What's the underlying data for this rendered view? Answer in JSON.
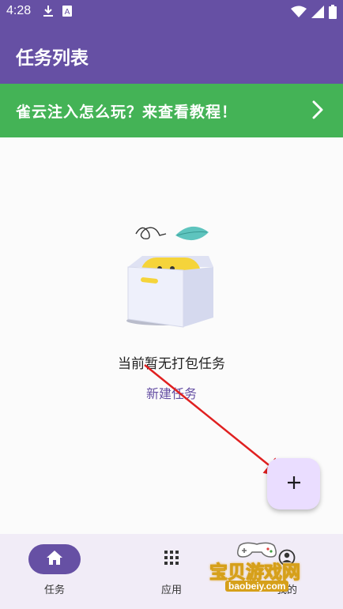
{
  "status_bar": {
    "time": "4:28",
    "left_icons": [
      "download-icon",
      "a-notification-icon"
    ],
    "right_icons": [
      "wifi-icon",
      "signal-icon",
      "battery-icon"
    ]
  },
  "app_bar": {
    "title": "任务列表"
  },
  "banner": {
    "text": "雀云注入怎么玩？来查看教程！",
    "chevron_icon": "chevron-right-icon",
    "color": "#44b356"
  },
  "empty_state": {
    "message": "当前暂无打包任务",
    "action_label": "新建任务",
    "illustration_icon": "empty-box-icon"
  },
  "fab": {
    "label": "+",
    "icon": "plus-icon",
    "color": "#eaddff"
  },
  "bottom_nav": {
    "items": [
      {
        "label": "任务",
        "icon": "home-icon",
        "active": true
      },
      {
        "label": "应用",
        "icon": "apps-grid-icon",
        "active": false
      },
      {
        "label": "我的",
        "icon": "person-icon",
        "active": false
      }
    ]
  },
  "watermark": {
    "text": "宝贝游戏网",
    "url": "baobeiy.com"
  },
  "colors": {
    "primary": "#6650a4",
    "accent_arrow": "#e02020",
    "background": "#fbfbfb"
  }
}
